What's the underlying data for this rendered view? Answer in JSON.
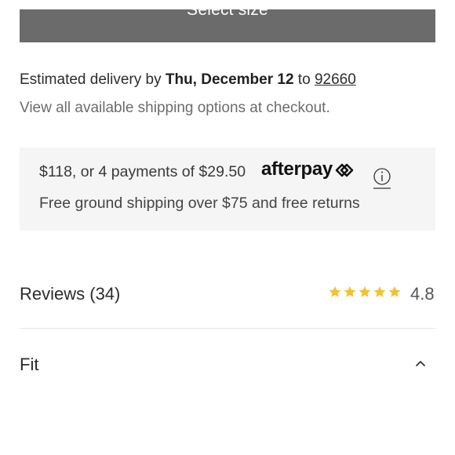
{
  "select_size": {
    "label": "Select size"
  },
  "delivery": {
    "prefix": "Estimated delivery by ",
    "date": "Thu, December 12",
    "mid": " to ",
    "zip": "92660"
  },
  "shipping_note": "View all available shipping options at checkout.",
  "afterpay": {
    "payment_text": "$118, or 4 payments of $29.50",
    "logo_text": "afterpay",
    "info_icon": "info-icon",
    "free_shipping_text": "Free ground shipping over $75 and free returns"
  },
  "reviews": {
    "label": "Reviews (34)",
    "rating": "4.8",
    "stars": 5,
    "star_color": "#f2c230"
  },
  "fit": {
    "label": "Fit",
    "icon": "chevron-up-icon"
  },
  "colors": {
    "button_bg": "#6b6b6b",
    "panel_bg": "#f5f5f5",
    "star": "#f2c230"
  }
}
